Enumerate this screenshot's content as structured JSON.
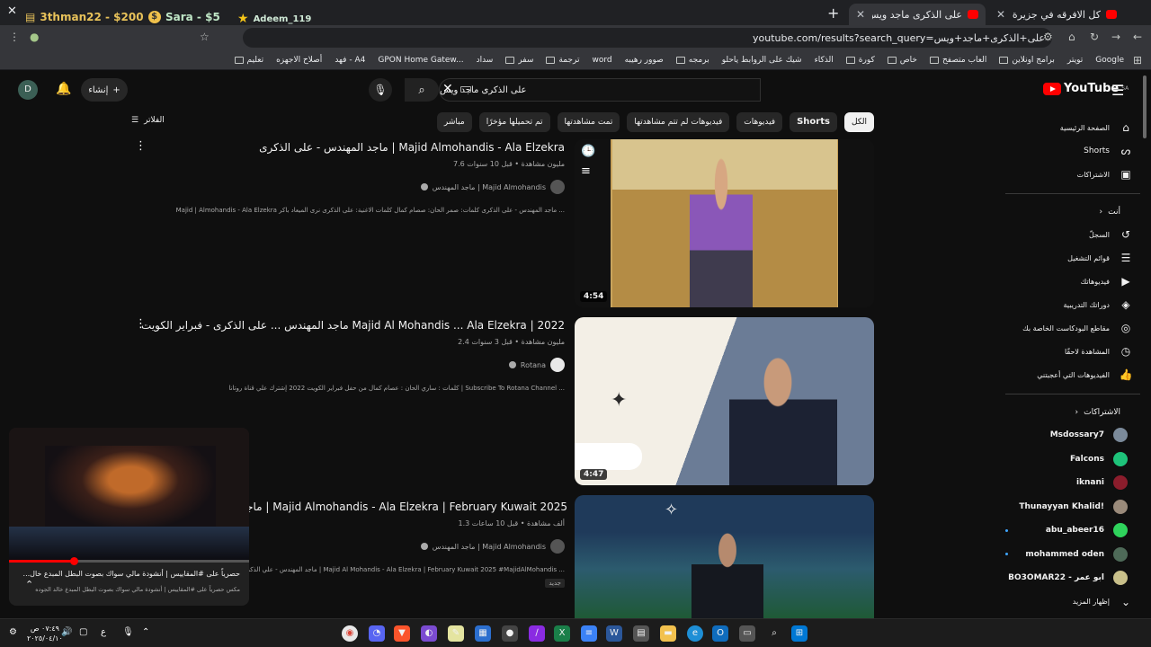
{
  "browser": {
    "tabs": [
      {
        "title": "كل الافرقه في جزيرة وحده ! #1 - ..."
      },
      {
        "title": "على الذكرى ماجد ويس - YouTube"
      }
    ],
    "url": "youtube.com/results?search_query=على+الذكرى+ماجد+ويس",
    "overlay": [
      {
        "text": "3thman22 - $200"
      },
      {
        "text": "Sara - $5"
      },
      {
        "text": "Adeem_119"
      }
    ],
    "bookmarks": [
      "Google",
      "تويتر",
      "برامج اونلاين",
      "العاب متصفح",
      "خاص",
      "كورة",
      "الذكاء",
      "شيك على الروابط ياحلو",
      "برمجه",
      "صوور رهيبه",
      "word",
      "ترجمة",
      "سفر",
      "سداد",
      "GPON Home Gatew...",
      "فهد - A4",
      "أصلاح الاجهزه",
      "تعليم"
    ]
  },
  "youtube": {
    "logo": "YouTube",
    "logo_region": "SA",
    "search_value": "على الذكرى ماجد ويس",
    "create_label": "إنشاء",
    "avatar_letter": "D",
    "filters_label": "الفلاتر",
    "chips": [
      "الكل",
      "Shorts",
      "فيديوهات",
      "فيديوهات لم تتم مشاهدتها",
      "تمت مشاهدتها",
      "تم تحميلها مؤخرًا",
      "مباشر"
    ],
    "results": [
      {
        "title": "ماجد المهندس - على الذكرى | Majid Almohandis - Ala Elzekra",
        "meta": "7.6 مليون مشاهدة • قبل 10 سنوات",
        "channel": "ماجد المهندس | Majid Almohandis",
        "desc": "Majid | Almohandis - Ala Elzekra ماجد المهندس - على الذكرى كلمات: صمر الحان: صصام كمال كلمات الاغنية: على الذكرى نرى الميعاد باكر ...",
        "duration": "4:54"
      },
      {
        "title": "ماجد المهندس ... على الذكرى - فبراير الكويت Majid Al Mohandis ... Ala Elzekra | 2022",
        "meta": "2.4 مليون مشاهدة • قبل 3 سنوات",
        "channel": "Rotana",
        "desc": "كلمات : ساري الحان : عصام كمال من حفل فبراير الكويت 2022 إشترك علي قناة روتانا | Subscribe To Rotana Channel ...",
        "duration": "4:47"
      },
      {
        "title": "ماجد المهندس - علي الذكري | Majid Almohandis - Ala Elzekra | February Kuwait 2025",
        "meta": "1.3 ألف مشاهدة • قبل 10 ساعات",
        "channel": "ماجد المهندس | Majid Almohandis",
        "desc": "ماجد المهندس - علي الذكري | Majid Al Mohandis - Ala Elzekra | February Kuwait 2025 #MajidAlMohandis ...",
        "badge": "جديد",
        "duration": ""
      }
    ],
    "sidebar": {
      "main": [
        "الصفحة الرئيسية",
        "Shorts",
        "الاشتراكات"
      ],
      "you_label": "أنت",
      "you_items": [
        "السجلّ",
        "قوائم التشغيل",
        "فيديوهاتك",
        "دوراتك التدريبية",
        "مقاطع البودكاست الخاصة بك",
        "المشاهدة لاحقًا",
        "الفيديوهات التي أعجبتني"
      ],
      "subs_label": "الاشتراكات",
      "subscriptions": [
        "Msdossary7",
        "Falcons",
        "iknani",
        "Thunayyan Khalid!",
        "abu_abeer16",
        "mohammed oden",
        "BO3OMAR22 - ابو عمر"
      ],
      "show_more": "إظهار المزيد"
    },
    "mini_player": {
      "title": "حصرياً على #المقاييس | أنشودة مالي سواك بصوت البطل المبدع خال...",
      "subtitle": "مكس حصرياً على #المقاييس | أنشودة مالي سواك بصوت البطل المبدع خالد الجوده",
      "progress": 0.27
    }
  },
  "taskbar": {
    "time": "٠٧:٤٩ ص",
    "date": "٢٠٢٥/٠٤/١٠",
    "lang": "ع"
  },
  "colors": {
    "accent": "#ff0000",
    "bg": "#0f0f0f",
    "chrome": "#35363a"
  }
}
